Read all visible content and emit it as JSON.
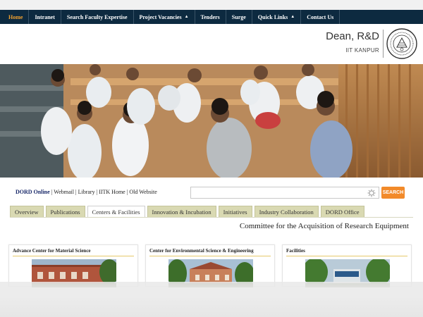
{
  "nav": {
    "items": [
      {
        "label": "Home",
        "active": true,
        "dropdown": false
      },
      {
        "label": "Intranet",
        "active": false,
        "dropdown": false
      },
      {
        "label": "Search Faculty Expertise",
        "active": false,
        "dropdown": false
      },
      {
        "label": "Project Vacancies",
        "active": false,
        "dropdown": true
      },
      {
        "label": "Tenders",
        "active": false,
        "dropdown": false
      },
      {
        "label": "Surge",
        "active": false,
        "dropdown": false
      },
      {
        "label": "Quick Links",
        "active": false,
        "dropdown": true
      },
      {
        "label": "Contact Us",
        "active": false,
        "dropdown": false
      }
    ],
    "colors": {
      "background": "#0d2a40",
      "active": "#f0a030"
    }
  },
  "header": {
    "title": "Dean, R&D",
    "subtitle": "IIT KANPUR"
  },
  "links": {
    "items": [
      "DORD Online",
      "Webmail",
      "Library",
      "IITK Home",
      "Old Website"
    ]
  },
  "search": {
    "placeholder": "",
    "value": "",
    "button_label": "SEARCH",
    "button_color": "#f28a2a"
  },
  "tabs": {
    "items": [
      {
        "label": "Overview",
        "active": false
      },
      {
        "label": "Publications",
        "active": false
      },
      {
        "label": "Centers & Facilities",
        "active": true
      },
      {
        "label": "Innovation & Incubation",
        "active": false
      },
      {
        "label": "Initiatives",
        "active": false
      },
      {
        "label": "Industry Collaboration",
        "active": false
      },
      {
        "label": "DORD Office",
        "active": false
      }
    ]
  },
  "main": {
    "heading": "Committee for the Acquisition of Research Equipment"
  },
  "cards": [
    {
      "title": "Advance Center for Material Science"
    },
    {
      "title": "Center for Environmental Science & Engineering"
    },
    {
      "title": "Facilities"
    }
  ]
}
